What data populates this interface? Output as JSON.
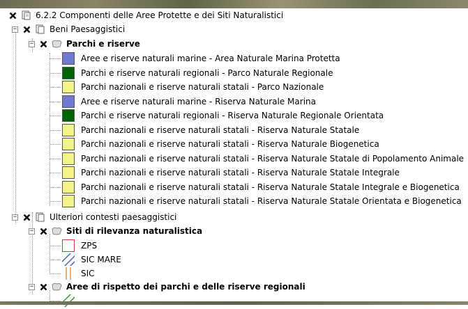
{
  "colors": {
    "blue": "#6f79cf",
    "green": "#006400",
    "yellow": "#f3f488",
    "zps": "#d93a3a",
    "sicmare": "#4d6fd0",
    "sic": "#e89a4f",
    "aree": "#3da63d"
  },
  "root": {
    "label": "6.2.2 Componenti delle  Aree Protette e dei Siti Naturalistici"
  },
  "beni": {
    "label": "Beni Paesaggistici"
  },
  "parchi": {
    "label": "Parchi e riserve"
  },
  "parchi_items": [
    {
      "label": "Aree e riserve naturali marine - Area Naturale Marina Protetta",
      "color": "blue"
    },
    {
      "label": "Parchi e riserve naturali regionali - Parco Naturale Regionale",
      "color": "green"
    },
    {
      "label": "Parchi nazionali e riserve naturali statali - Parco Nazionale",
      "color": "yellow"
    },
    {
      "label": "Aree e riserve naturali marine - Riserva Naturale Marina",
      "color": "blue"
    },
    {
      "label": "Parchi e riserve naturali regionali - Riserva Naturale Regionale Orientata",
      "color": "green"
    },
    {
      "label": "Parchi nazionali e riserve naturali statali - Riserva Naturale Statale",
      "color": "yellow"
    },
    {
      "label": "Parchi nazionali e riserve naturali statali - Riserva Naturale Biogenetica",
      "color": "yellow"
    },
    {
      "label": "Parchi nazionali e riserve naturali statali - Riserva Naturale Statale di Popolamento Animale",
      "color": "yellow"
    },
    {
      "label": "Parchi nazionali e riserve naturali statali - Riserva Naturale Statale Integrale",
      "color": "yellow"
    },
    {
      "label": "Parchi nazionali e riserve naturali statali - Riserva Naturale Statale Integrale e Biogenetica",
      "color": "yellow"
    },
    {
      "label": "Parchi nazionali e riserve naturali statali - Riserva Naturale Statale Orientata e Biogenetica",
      "color": "yellow"
    }
  ],
  "ulteriori": {
    "label": "Ulteriori contesti paesaggistici"
  },
  "siti": {
    "label": "Siti di rilevanza naturalistica"
  },
  "siti_items": [
    {
      "label": "ZPS",
      "icon": "zps-outline-swatch"
    },
    {
      "label": "SIC MARE",
      "icon": "sic-mare-hatch-swatch"
    },
    {
      "label": "SIC",
      "icon": "sic-lines-swatch"
    }
  ],
  "aree": {
    "label": "Aree di rispetto dei parchi e delle riserve regionali"
  }
}
